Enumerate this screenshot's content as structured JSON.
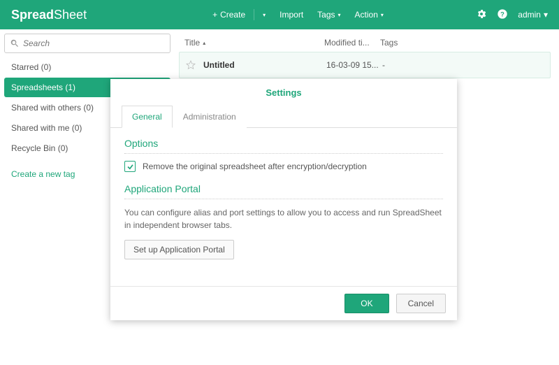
{
  "app": {
    "name_bold": "Spread",
    "name_light": "Sheet"
  },
  "toolbar": {
    "create": "Create",
    "import": "Import",
    "tags": "Tags",
    "action": "Action"
  },
  "user": {
    "name": "admin"
  },
  "search": {
    "placeholder": "Search"
  },
  "sidebar": {
    "items": [
      {
        "label": "Starred  (0)"
      },
      {
        "label": "Spreadsheets  (1)"
      },
      {
        "label": "Shared with others  (0)"
      },
      {
        "label": "Shared with me  (0)"
      },
      {
        "label": "Recycle Bin  (0)"
      }
    ],
    "create_tag": "Create a new tag"
  },
  "list": {
    "header": {
      "title": "Title",
      "modified": "Modified ti...",
      "tags": "Tags"
    },
    "rows": [
      {
        "title": "Untitled",
        "modified": "16-03-09 15...",
        "tags": "-"
      }
    ]
  },
  "modal": {
    "title": "Settings",
    "tabs": {
      "general": "General",
      "admin": "Administration"
    },
    "options": {
      "heading": "Options",
      "remove_original": "Remove the original spreadsheet after encryption/decryption"
    },
    "portal": {
      "heading": "Application Portal",
      "desc": "You can configure alias and port settings to allow you to access and run SpreadSheet in independent browser tabs.",
      "button": "Set up Application Portal"
    },
    "ok": "OK",
    "cancel": "Cancel"
  }
}
